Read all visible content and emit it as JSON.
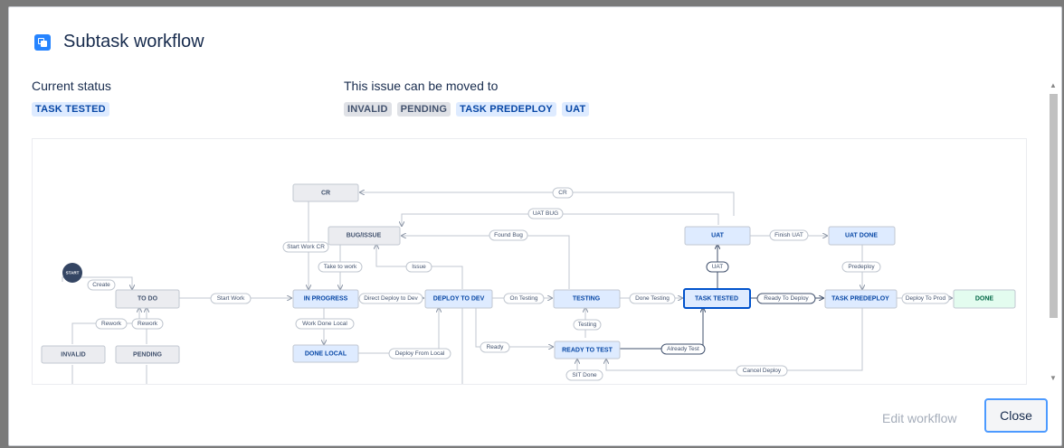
{
  "dialog": {
    "title": "Subtask workflow",
    "current_status_label": "Current status",
    "current_status": "TASK TESTED",
    "moved_to_label": "This issue can be moved to",
    "moved_to": [
      {
        "label": "INVALID",
        "color": "grey"
      },
      {
        "label": "PENDING",
        "color": "grey"
      },
      {
        "label": "TASK PREDEPLOY",
        "color": "blue"
      },
      {
        "label": "UAT",
        "color": "blue"
      }
    ],
    "edit_workflow": "Edit workflow",
    "close": "Close"
  },
  "workflow": {
    "start_label": "START",
    "statuses": [
      {
        "id": "todo",
        "label": "TO DO",
        "category": "grey"
      },
      {
        "id": "inprogress",
        "label": "IN PROGRESS",
        "category": "blue"
      },
      {
        "id": "deploydev",
        "label": "DEPLOY TO DEV",
        "category": "blue"
      },
      {
        "id": "testing",
        "label": "TESTING",
        "category": "blue"
      },
      {
        "id": "tasktested",
        "label": "TASK TESTED",
        "category": "blue",
        "current": true
      },
      {
        "id": "predeploy",
        "label": "TASK PREDEPLOY",
        "category": "blue"
      },
      {
        "id": "done",
        "label": "DONE",
        "category": "green"
      },
      {
        "id": "cr",
        "label": "CR",
        "category": "grey"
      },
      {
        "id": "bug",
        "label": "BUG/ISSUE",
        "category": "grey"
      },
      {
        "id": "uat",
        "label": "UAT",
        "category": "blue"
      },
      {
        "id": "uatdone",
        "label": "UAT DONE",
        "category": "blue"
      },
      {
        "id": "donelocal",
        "label": "DONE LOCAL",
        "category": "blue"
      },
      {
        "id": "readytest",
        "label": "READY TO TEST",
        "category": "blue"
      },
      {
        "id": "invalid",
        "label": "INVALID",
        "category": "grey"
      },
      {
        "id": "pending",
        "label": "PENDING",
        "category": "grey"
      }
    ],
    "transitions": [
      {
        "id": "create",
        "label": "Create"
      },
      {
        "id": "startwork",
        "label": "Start Work"
      },
      {
        "id": "direct",
        "label": "Direct Deploy to Dev"
      },
      {
        "id": "ontesting",
        "label": "On Testing"
      },
      {
        "id": "donetesting",
        "label": "Done Testing"
      },
      {
        "id": "readydeploy",
        "label": "Ready To Deploy"
      },
      {
        "id": "deployprod",
        "label": "Deploy To Prod"
      },
      {
        "id": "cr",
        "label": "CR"
      },
      {
        "id": "uatbug",
        "label": "UAT BUG"
      },
      {
        "id": "startworkcr",
        "label": "Start Work CR"
      },
      {
        "id": "foundbug",
        "label": "Found Bug"
      },
      {
        "id": "taketowork",
        "label": "Take to work"
      },
      {
        "id": "issue",
        "label": "Issue"
      },
      {
        "id": "finishuat",
        "label": "Finish UAT"
      },
      {
        "id": "uat",
        "label": "UAT"
      },
      {
        "id": "predeploy",
        "label": "Predeploy"
      },
      {
        "id": "rework1",
        "label": "Rework"
      },
      {
        "id": "rework2",
        "label": "Rework"
      },
      {
        "id": "workdonelocal",
        "label": "Work Done Local"
      },
      {
        "id": "deploylocal",
        "label": "Deploy From Local"
      },
      {
        "id": "ready",
        "label": "Ready"
      },
      {
        "id": "testing",
        "label": "Testing"
      },
      {
        "id": "alreadytest",
        "label": "Already Test"
      },
      {
        "id": "sitdone",
        "label": "SIT Done"
      },
      {
        "id": "canceldeploy",
        "label": "Cancel Deploy"
      }
    ]
  }
}
